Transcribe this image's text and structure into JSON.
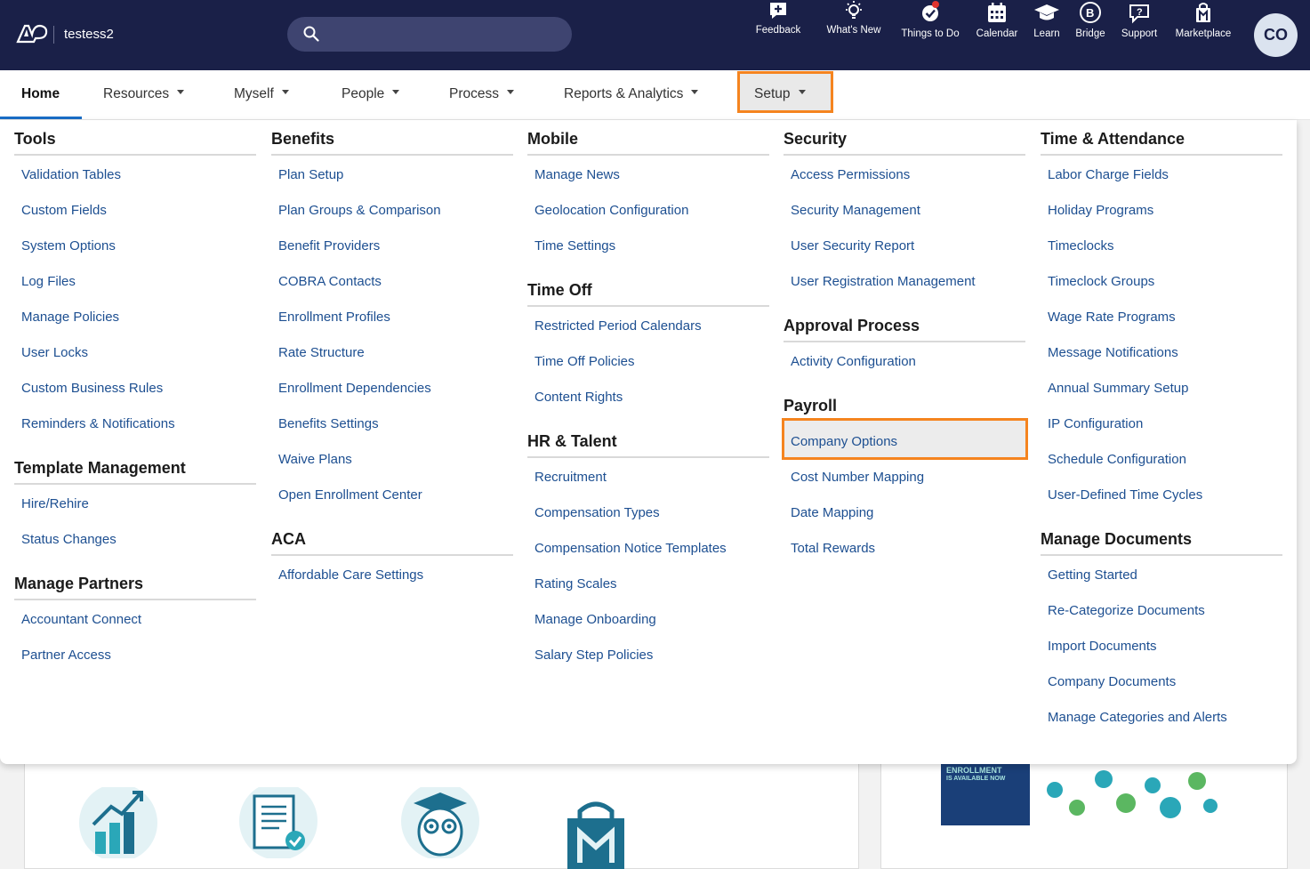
{
  "header": {
    "company": "testess2",
    "search_placeholder": "",
    "tools": [
      {
        "label": "Feedback",
        "icon": "feedback-icon"
      },
      {
        "label": "What's New",
        "icon": "lightbulb-icon"
      },
      {
        "label": "Things to Do",
        "icon": "checkmark-icon"
      },
      {
        "label": "Calendar",
        "icon": "calendar-icon"
      },
      {
        "label": "Learn",
        "icon": "graduation-cap-icon"
      },
      {
        "label": "Bridge",
        "icon": "bridge-icon"
      },
      {
        "label": "Support",
        "icon": "chat-question-icon"
      },
      {
        "label": "Marketplace",
        "icon": "marketplace-bag-icon"
      }
    ],
    "avatar_initials": "CO"
  },
  "nav": {
    "items": [
      "Home",
      "Resources",
      "Myself",
      "People",
      "Process",
      "Reports & Analytics",
      "Setup"
    ]
  },
  "menu": {
    "tools": {
      "title": "Tools",
      "links": [
        "Validation Tables",
        "Custom Fields",
        "System Options",
        "Log Files",
        "Manage Policies",
        "User Locks",
        "Custom Business Rules",
        "Reminders & Notifications"
      ]
    },
    "template_management": {
      "title": "Template Management",
      "links": [
        "Hire/Rehire",
        "Status Changes"
      ]
    },
    "manage_partners": {
      "title": "Manage Partners",
      "links": [
        "Accountant Connect",
        "Partner Access"
      ]
    },
    "benefits": {
      "title": "Benefits",
      "links": [
        "Plan Setup",
        "Plan Groups & Comparison",
        "Benefit Providers",
        "COBRA Contacts",
        "Enrollment Profiles",
        "Rate Structure",
        "Enrollment Dependencies",
        "Benefits Settings",
        "Waive Plans",
        "Open Enrollment Center"
      ]
    },
    "aca": {
      "title": "ACA",
      "links": [
        "Affordable Care Settings"
      ]
    },
    "mobile": {
      "title": "Mobile",
      "links": [
        "Manage News",
        "Geolocation Configuration",
        "Time Settings"
      ]
    },
    "time_off": {
      "title": "Time Off",
      "links": [
        "Restricted Period Calendars",
        "Time Off Policies",
        "Content Rights"
      ]
    },
    "hr_talent": {
      "title": "HR & Talent",
      "links": [
        "Recruitment",
        "Compensation Types",
        "Compensation Notice Templates",
        "Rating Scales",
        "Manage Onboarding",
        "Salary Step Policies"
      ]
    },
    "security": {
      "title": "Security",
      "links": [
        "Access Permissions",
        "Security Management",
        "User Security Report",
        "User Registration Management"
      ]
    },
    "approval_process": {
      "title": "Approval Process",
      "links": [
        "Activity Configuration"
      ]
    },
    "payroll": {
      "title": "Payroll",
      "links": [
        "Company Options",
        "Cost Number Mapping",
        "Date Mapping",
        "Total Rewards"
      ]
    },
    "time_attendance": {
      "title": "Time & Attendance",
      "links": [
        "Labor Charge Fields",
        "Holiday Programs",
        "Timeclocks",
        "Timeclock Groups",
        "Wage Rate Programs",
        "Message Notifications",
        "Annual Summary Setup",
        "IP Configuration",
        "Schedule Configuration",
        "User-Defined Time Cycles"
      ]
    },
    "manage_documents": {
      "title": "Manage Documents",
      "links": [
        "Getting Started",
        "Re-Categorize Documents",
        "Import Documents",
        "Company Documents",
        "Manage Categories and Alerts"
      ]
    }
  },
  "background": {
    "banner_line1": "ENROLLMENT",
    "banner_line2": "IS AVAILABLE NOW"
  },
  "colors": {
    "header_bg": "#1a2048",
    "link": "#1d4f91",
    "highlight": "#f5841f",
    "active_tab_underline": "#1a6ec7"
  }
}
